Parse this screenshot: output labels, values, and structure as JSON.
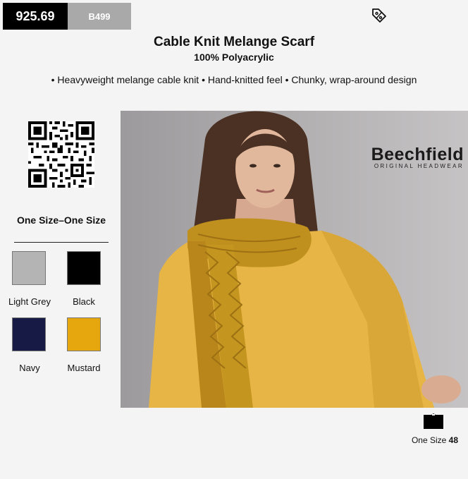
{
  "header": {
    "price_code": "925.69",
    "style_code": "B499",
    "tag_icon": "tag-percent-icon"
  },
  "product": {
    "title": "Cable Knit Melange Scarf",
    "material": "100% Polyacrylic",
    "features": "• Heavyweight melange cable knit • Hand-knitted feel • Chunky, wrap-around design"
  },
  "sizes": {
    "heading": "One Size–One Size"
  },
  "colours": [
    {
      "name": "Light Grey",
      "hex": "#b4b4b4"
    },
    {
      "name": "Black",
      "hex": "#000000"
    },
    {
      "name": "Navy",
      "hex": "#161a44"
    },
    {
      "name": "Mustard",
      "hex": "#e6a70e"
    }
  ],
  "brand": {
    "logo": "Beechfield",
    "tagline": "ORIGINAL HEADWEAR"
  },
  "size_chart": {
    "label": "One Size",
    "value": "48"
  }
}
